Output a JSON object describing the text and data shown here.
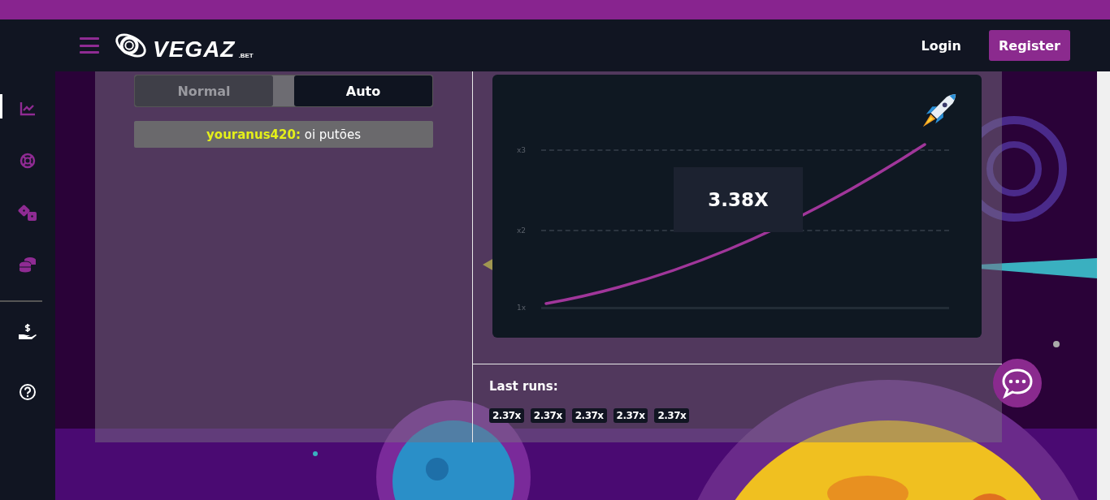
{
  "header": {
    "logo": {
      "name": "VEGAZ",
      "suffix": ".BET"
    },
    "login": "Login",
    "register": "Register"
  },
  "sidebar": {
    "items": [
      {
        "kind": "chart",
        "selected": true
      },
      {
        "kind": "lifebuoy",
        "selected": false
      },
      {
        "kind": "dice",
        "selected": false
      },
      {
        "kind": "coins",
        "selected": false
      },
      {
        "kind": "payment",
        "selected": false
      },
      {
        "kind": "help",
        "selected": false
      }
    ]
  },
  "mode_tabs": [
    {
      "label": "Normal",
      "selected": false
    },
    {
      "label": "Auto",
      "selected": true
    }
  ],
  "chat_message": {
    "username": "youranus420:",
    "text": "oi putões"
  },
  "game": {
    "multiplier": "3.38X",
    "y_ticks": [
      "x3",
      "x2",
      "1x"
    ]
  },
  "last_runs": {
    "title": "Last runs:",
    "runs": [
      "2.37x",
      "2.37x",
      "2.37x",
      "2.37x",
      "2.37x"
    ]
  }
}
